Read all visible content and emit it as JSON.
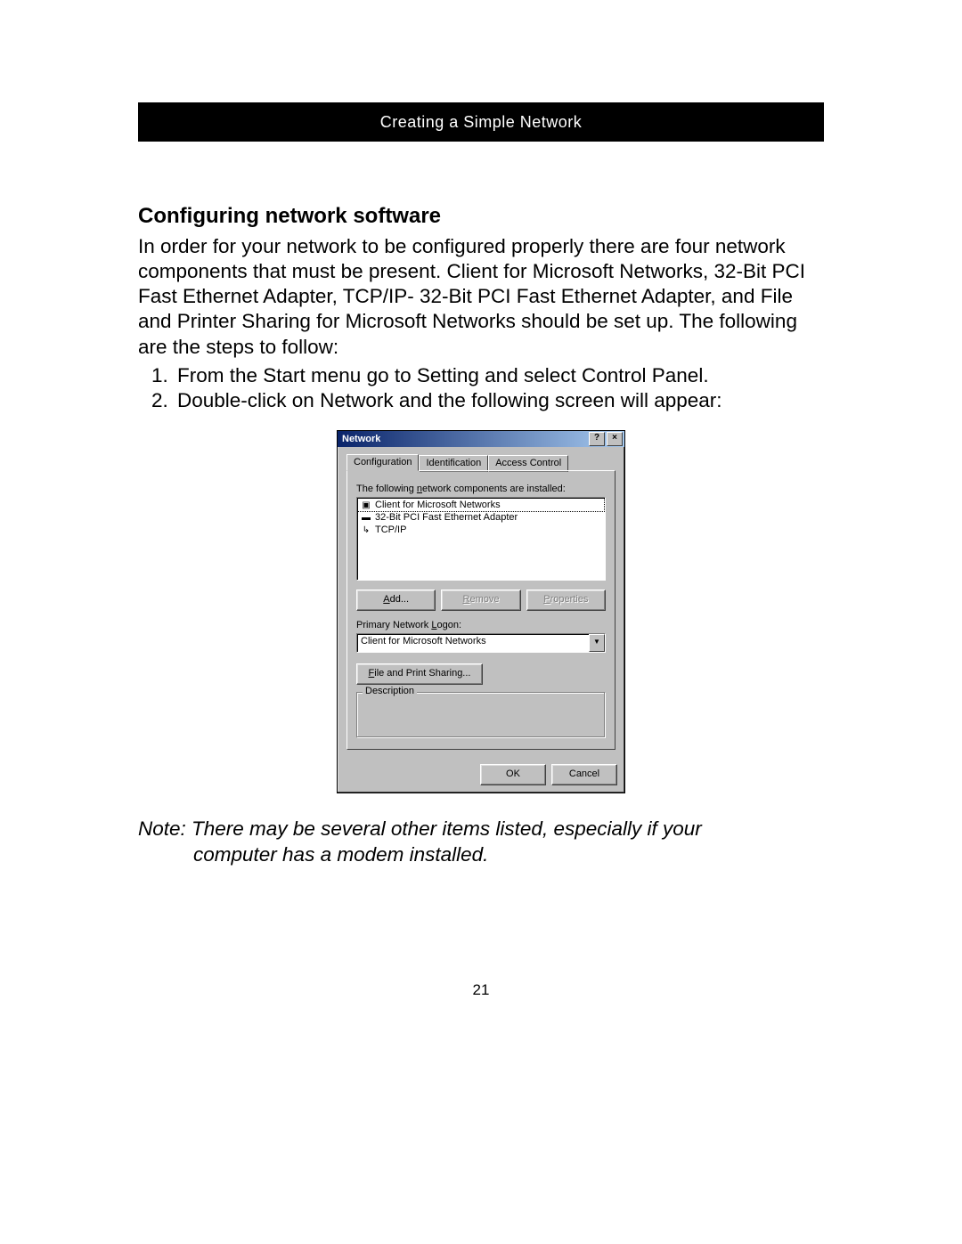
{
  "header": {
    "title": "Creating a Simple Network"
  },
  "section": {
    "heading": "Configuring network software",
    "intro": "In order for your network to be configured properly there are four network components that must be present. Client for Microsoft Networks, 32-Bit PCI Fast Ethernet Adapter, TCP/IP- 32-Bit PCI Fast Ethernet Adapter, and File and Printer Sharing for Microsoft Networks should be set up. The following are the steps to follow:",
    "steps": [
      "From the Start menu go to Setting and select Control Panel.",
      "Double-click on Network and the following screen will appear:"
    ],
    "note_line1": "Note: There may be several other items listed, especially if your",
    "note_line2": "computer has a modem installed."
  },
  "dialog": {
    "title": "Network",
    "help_glyph": "?",
    "close_glyph": "×",
    "tabs": [
      "Configuration",
      "Identification",
      "Access Control"
    ],
    "active_tab": 0,
    "components_label_pre": "The following ",
    "components_label_u": "n",
    "components_label_post": "etwork components are installed:",
    "components": [
      {
        "icon": "client-icon",
        "glyph": "▣",
        "label": "Client for Microsoft Networks",
        "selected": true
      },
      {
        "icon": "adapter-icon",
        "glyph": "▬",
        "label": "32-Bit PCI Fast Ethernet Adapter",
        "selected": false
      },
      {
        "icon": "protocol-icon",
        "glyph": "↳",
        "label": "TCP/IP",
        "selected": false
      }
    ],
    "buttons": {
      "add_u": "A",
      "add_post": "dd...",
      "remove_u": "R",
      "remove_pre": "",
      "remove_post": "emove",
      "properties_u": "P",
      "properties_post": "roperties"
    },
    "logon_label_pre": "Primary Network ",
    "logon_label_u": "L",
    "logon_label_post": "ogon:",
    "logon_value": "Client for Microsoft Networks",
    "fps_u": "F",
    "fps_post": "ile and Print Sharing...",
    "description_label": "Description",
    "ok": "OK",
    "cancel": "Cancel",
    "dropdown_glyph": "▼"
  },
  "page_number": "21"
}
